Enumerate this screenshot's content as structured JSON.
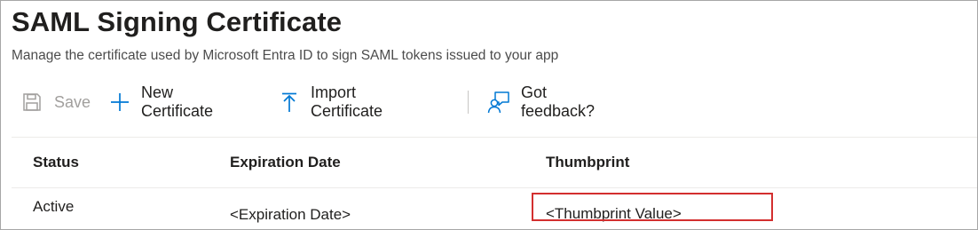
{
  "header": {
    "title": "SAML Signing Certificate",
    "subtitle": "Manage the certificate used by Microsoft Entra ID to sign SAML tokens issued to your app"
  },
  "toolbar": {
    "save_label": "Save",
    "new_certificate_label": "New Certificate",
    "import_certificate_label": "Import Certificate",
    "feedback_label": "Got feedback?"
  },
  "table": {
    "columns": [
      "Status",
      "Expiration Date",
      "Thumbprint"
    ],
    "rows": [
      {
        "status": "Active",
        "expiration_date": "<Expiration Date>",
        "thumbprint": "<Thumbprint Value>"
      }
    ]
  },
  "colors": {
    "accent": "#0078d4",
    "highlight": "#d32f2f",
    "disabled": "#a19f9d"
  },
  "icons": {
    "save": "save-icon",
    "new": "plus-icon",
    "import": "upload-icon",
    "feedback": "feedback-icon"
  }
}
